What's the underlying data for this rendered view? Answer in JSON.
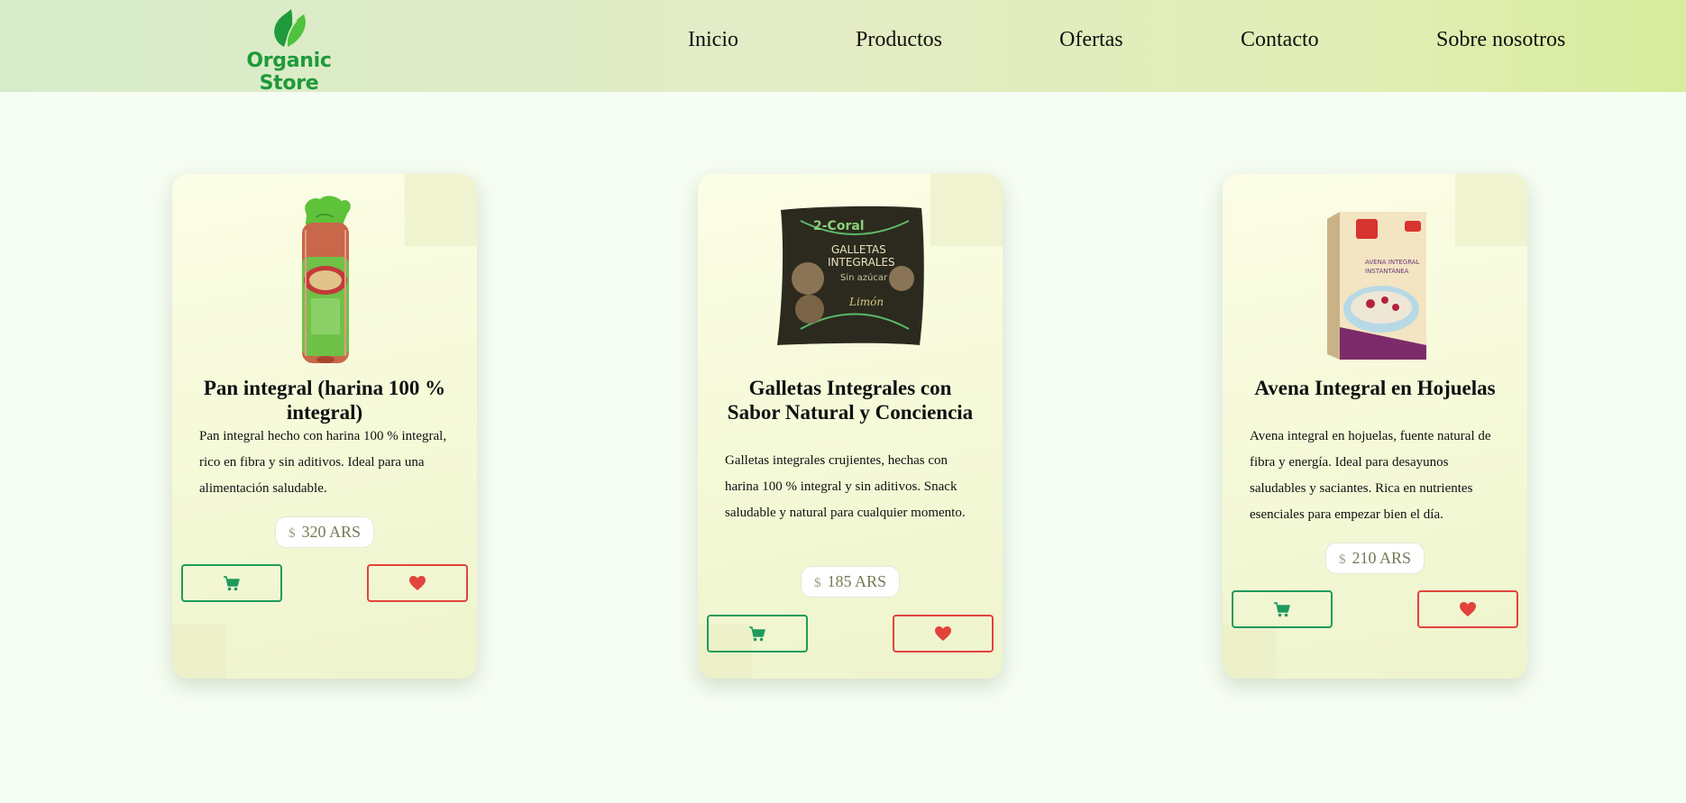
{
  "header": {
    "brand": "Organic Store",
    "nav": [
      "Inicio",
      "Productos",
      "Ofertas",
      "Contacto",
      "Sobre nosotros"
    ]
  },
  "colors": {
    "brand_green": "#1e9a3a",
    "cart_green": "#1e9b5c",
    "favorite_red": "#e2433b"
  },
  "products": [
    {
      "title": "Pan integral (harina 100 % integral)",
      "description": "Pan integral hecho con harina 100 % integral, rico en fibra y sin aditivos. Ideal para una alimentación saludable.",
      "currency_symbol": "$",
      "price": "320 ARS",
      "image": "whole-wheat-bread-bag",
      "cart_icon": "cart-icon",
      "fav_icon": "heart-icon"
    },
    {
      "title": "Galletas Integrales con Sabor Natural y Conciencia",
      "description": "Galletas integrales crujientes, hechas con harina 100 % integral y sin aditivos. Snack saludable y natural para cualquier momento.",
      "currency_symbol": "$",
      "price": "185 ARS",
      "image": "whole-grain-cookies-bag",
      "cart_icon": "cart-icon",
      "fav_icon": "heart-icon"
    },
    {
      "title": "Avena Integral en Hojuelas",
      "description": "Avena integral en hojuelas, fuente natural de fibra y energía. Ideal para desayunos saludables y saciantes. Rica en nutrientes esenciales para empezar bien el día.",
      "currency_symbol": "$",
      "price": "210 ARS",
      "image": "oat-flakes-box",
      "cart_icon": "cart-icon",
      "fav_icon": "heart-icon"
    }
  ]
}
